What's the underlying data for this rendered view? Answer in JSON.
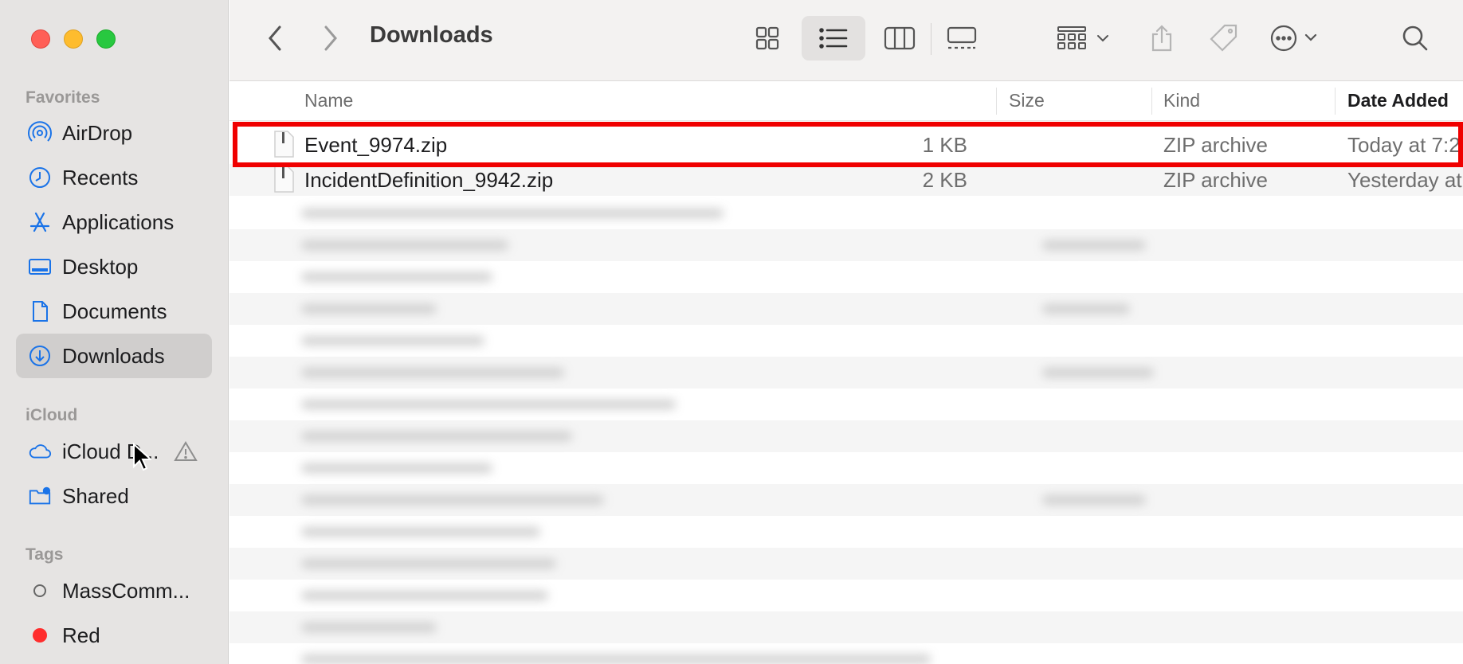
{
  "window": {
    "title": "Downloads"
  },
  "sidebar": {
    "sections": {
      "favorites": "Favorites",
      "icloud": "iCloud",
      "tags": "Tags"
    },
    "favorites": [
      {
        "label": "AirDrop",
        "icon": "airdrop-icon"
      },
      {
        "label": "Recents",
        "icon": "clock-icon"
      },
      {
        "label": "Applications",
        "icon": "applications-icon"
      },
      {
        "label": "Desktop",
        "icon": "desktop-icon"
      },
      {
        "label": "Documents",
        "icon": "document-icon"
      },
      {
        "label": "Downloads",
        "icon": "download-icon",
        "selected": true
      }
    ],
    "icloud": [
      {
        "label": "iCloud D...",
        "icon": "cloud-icon",
        "badge": "warning-icon"
      },
      {
        "label": "Shared",
        "icon": "shared-folder-icon"
      }
    ],
    "tags": [
      {
        "label": "MassComm...",
        "color": "none"
      },
      {
        "label": "Red",
        "color": "#ff2d2d"
      }
    ]
  },
  "toolbar": {
    "title": "Downloads",
    "icons": [
      "back-icon",
      "forward-icon",
      "icon-view-icon",
      "list-view-icon",
      "column-view-icon",
      "gallery-view-icon",
      "group-icon",
      "share-icon",
      "tag-icon",
      "more-icon",
      "search-icon"
    ],
    "active_view": "list"
  },
  "columns": {
    "name": "Name",
    "size": "Size",
    "kind": "Kind",
    "date_added": "Date Added"
  },
  "files": [
    {
      "name": "Event_9974.zip",
      "size": "1 KB",
      "kind": "ZIP archive",
      "date": "Today at 7:2",
      "highlighted": true
    },
    {
      "name": "IncidentDefinition_9942.zip",
      "size": "2 KB",
      "kind": "ZIP archive",
      "date": "Yesterday at"
    }
  ],
  "colors": {
    "highlight": "#f00000",
    "accent": "#1a73e8"
  }
}
